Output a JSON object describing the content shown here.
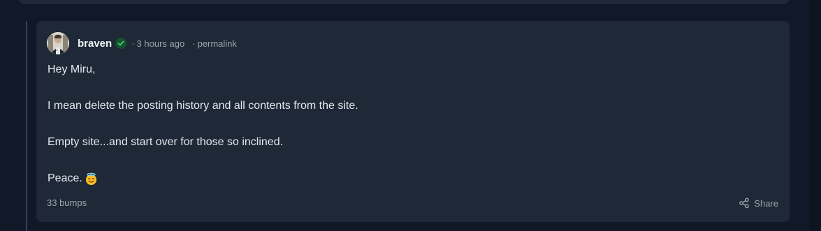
{
  "comment": {
    "author": "braven",
    "separator": "·",
    "time_ago": "3 hours ago",
    "permalink_label": "permalink",
    "body": {
      "line1": "Hey Miru,",
      "line2": "I mean delete the posting history and all contents from the site.",
      "line3": "Empty site...and start over for those so inclined.",
      "line4": "Peace."
    },
    "emoji_icon": "smiling-face-with-halo-icon",
    "bumps_label": "33 bumps",
    "share_label": "Share"
  },
  "colors": {
    "background": "#111827",
    "card": "#1e2837",
    "verified_badge": "#14532d",
    "verified_check": "#4ade80",
    "muted_text": "#9ca3af",
    "body_text": "#e5e7eb"
  }
}
